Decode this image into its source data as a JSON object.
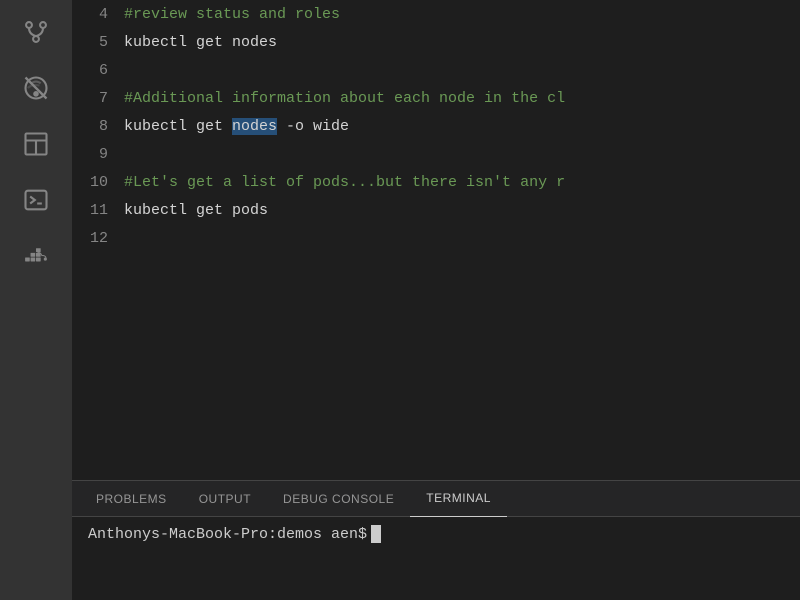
{
  "activityBar": {
    "icons": [
      {
        "name": "source-control-icon",
        "label": "Source Control"
      },
      {
        "name": "no-wifi-icon",
        "label": "Remote"
      },
      {
        "name": "layout-icon",
        "label": "Layout"
      },
      {
        "name": "terminal-icon",
        "label": "Terminal"
      },
      {
        "name": "docker-icon",
        "label": "Docker"
      }
    ]
  },
  "editor": {
    "lines": [
      {
        "number": "4",
        "type": "comment",
        "content": "#review status and roles"
      },
      {
        "number": "5",
        "type": "code",
        "content": "kubectl get nodes"
      },
      {
        "number": "6",
        "type": "empty",
        "content": ""
      },
      {
        "number": "7",
        "type": "comment",
        "content": "#Additional information about each node in the cl"
      },
      {
        "number": "8",
        "type": "code",
        "content": "kubectl get nodes -o wide",
        "highlight": "nodes"
      },
      {
        "number": "9",
        "type": "empty",
        "content": ""
      },
      {
        "number": "10",
        "type": "comment",
        "content": "#Let's get a list of pods...but there isn't any r"
      },
      {
        "number": "11",
        "type": "code",
        "content": "kubectl get pods"
      },
      {
        "number": "12",
        "type": "empty",
        "content": ""
      }
    ]
  },
  "panel": {
    "tabs": [
      {
        "label": "PROBLEMS",
        "active": false
      },
      {
        "label": "OUTPUT",
        "active": false
      },
      {
        "label": "DEBUG CONSOLE",
        "active": false
      },
      {
        "label": "TERMINAL",
        "active": true
      }
    ],
    "terminal": {
      "prompt": "Anthonys-MacBook-Pro:demos aen$ "
    }
  }
}
